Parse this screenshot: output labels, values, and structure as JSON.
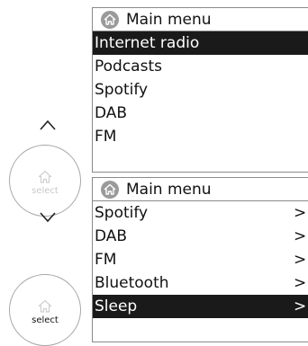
{
  "screens": [
    {
      "header": {
        "title": "Main menu",
        "icon": "home-icon"
      },
      "items": [
        {
          "label": "Internet radio",
          "selected": true,
          "arrow": ""
        },
        {
          "label": "Podcasts",
          "selected": false,
          "arrow": ""
        },
        {
          "label": "Spotify",
          "selected": false,
          "arrow": ""
        },
        {
          "label": "DAB",
          "selected": false,
          "arrow": ""
        },
        {
          "label": "FM",
          "selected": false,
          "arrow": ""
        }
      ]
    },
    {
      "header": {
        "title": "Main menu",
        "icon": "home-icon"
      },
      "items": [
        {
          "label": "Spotify",
          "selected": false,
          "arrow": ">"
        },
        {
          "label": "DAB",
          "selected": false,
          "arrow": ">"
        },
        {
          "label": "FM",
          "selected": false,
          "arrow": ">"
        },
        {
          "label": "Bluetooth",
          "selected": false,
          "arrow": ">"
        },
        {
          "label": "Sleep",
          "selected": true,
          "arrow": ">"
        }
      ]
    }
  ],
  "controls": {
    "knob_top": {
      "label": "select",
      "state": "inactive"
    },
    "knob_bottom": {
      "label": "select",
      "state": "active"
    },
    "up_icon": "chevron-up-icon",
    "down_icon": "chevron-down-icon"
  },
  "colors": {
    "selection_bg": "#1a1a1a",
    "selection_text": "#ffffff",
    "border": "#8a8a8a",
    "header_icon_bg": "#9a9a9a",
    "inactive_label": "#c9c9c9"
  }
}
